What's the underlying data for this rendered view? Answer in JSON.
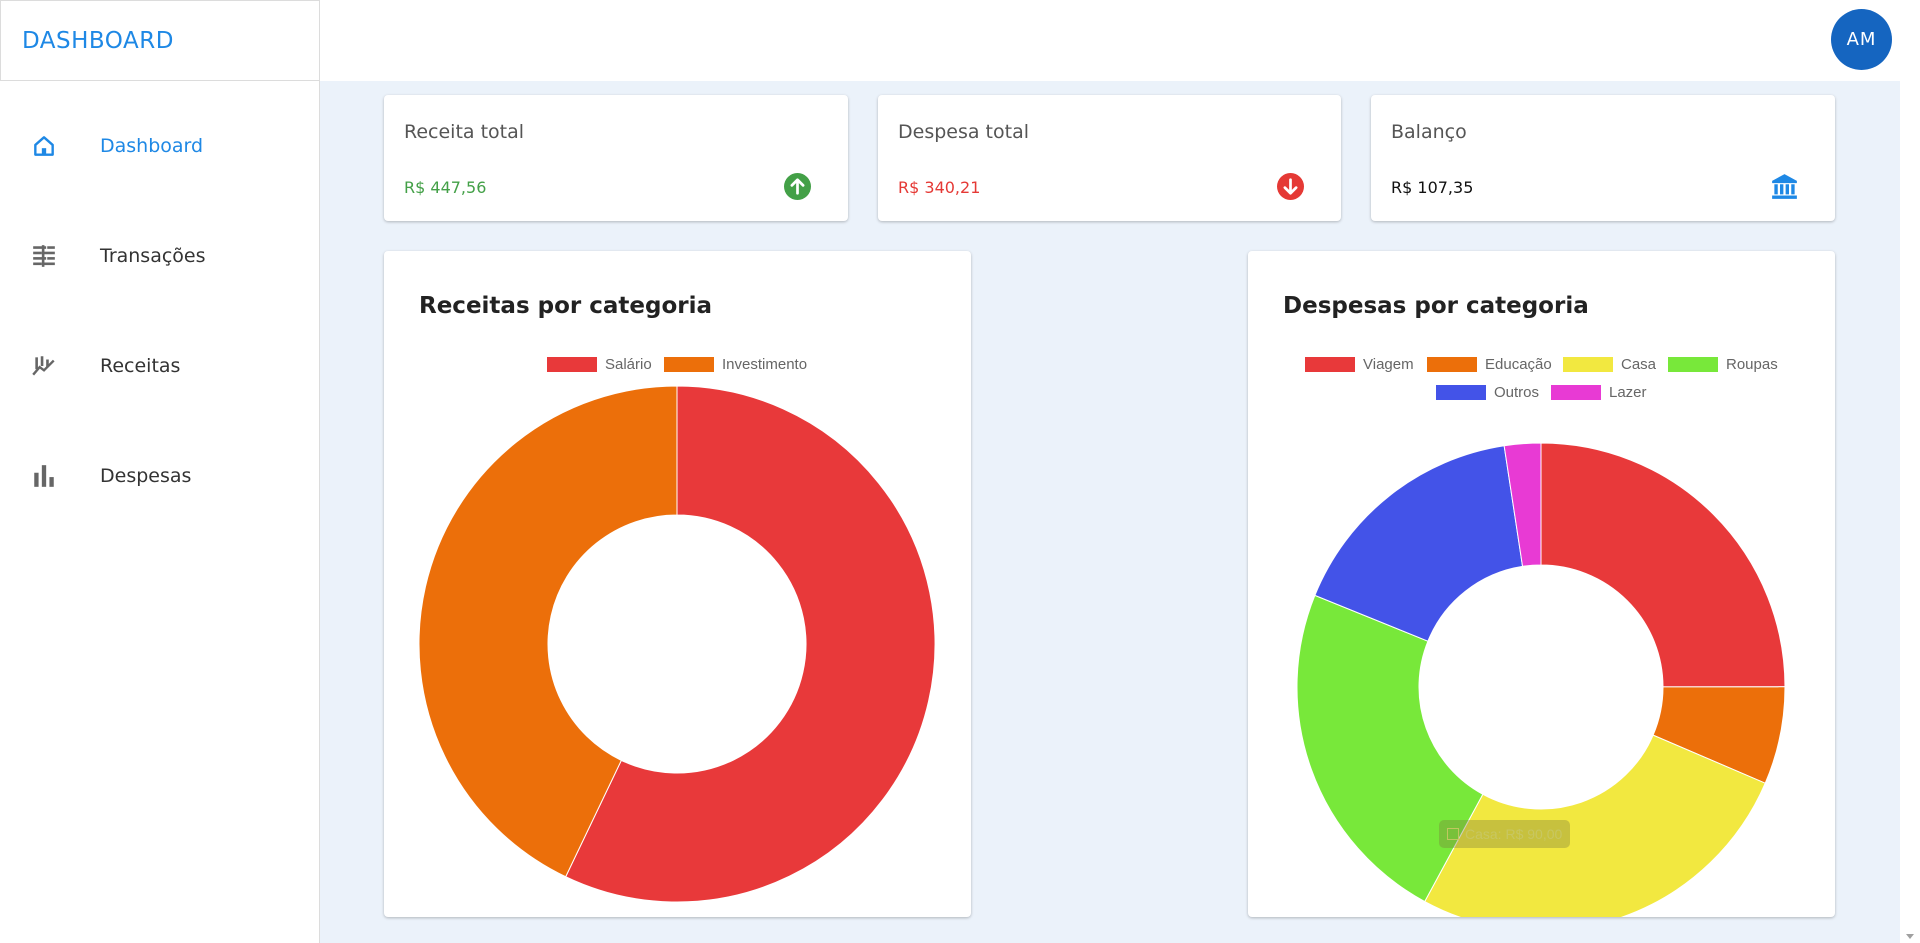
{
  "brand": {
    "title": "DASHBOARD"
  },
  "user": {
    "initials": "AM"
  },
  "sidebar": {
    "items": [
      {
        "label": "Dashboard",
        "icon": "home-icon",
        "active": true
      },
      {
        "label": "Transações",
        "icon": "transactions-icon",
        "active": false
      },
      {
        "label": "Receitas",
        "icon": "trending-icon",
        "active": false
      },
      {
        "label": "Despesas",
        "icon": "bar-chart-icon",
        "active": false
      }
    ]
  },
  "stats": {
    "income": {
      "title": "Receita total",
      "value": "R$ 447,56",
      "color": "#43a047",
      "icon": "arrow-up-circle-icon"
    },
    "expense": {
      "title": "Despesa total",
      "value": "R$ 340,21",
      "color": "#e53935",
      "icon": "arrow-down-circle-icon"
    },
    "balance": {
      "title": "Balanço",
      "value": "R$ 107,35",
      "color": "#111111",
      "icon": "bank-icon"
    }
  },
  "charts": {
    "income_title": "Receitas por categoria",
    "expense_title": "Despesas por categoria",
    "tooltip": "Casa: R$ 90,00"
  },
  "chart_data": [
    {
      "type": "pie",
      "title": "Receitas por categoria",
      "legend": "top",
      "categories": [
        "Salário",
        "Investimento"
      ],
      "values": [
        255.56,
        192.0
      ],
      "colors": [
        "#e8393a",
        "#ec6f0a"
      ]
    },
    {
      "type": "pie",
      "title": "Despesas por categoria",
      "legend": "top",
      "categories": [
        "Viagem",
        "Educação",
        "Casa",
        "Roupas",
        "Outros",
        "Lazer"
      ],
      "values": [
        85.0,
        22.0,
        90.0,
        79.0,
        56.0,
        8.21
      ],
      "colors": [
        "#e8393a",
        "#ec6f0a",
        "#f2e840",
        "#78e83a",
        "#4353e8",
        "#e83ad4"
      ]
    }
  ]
}
